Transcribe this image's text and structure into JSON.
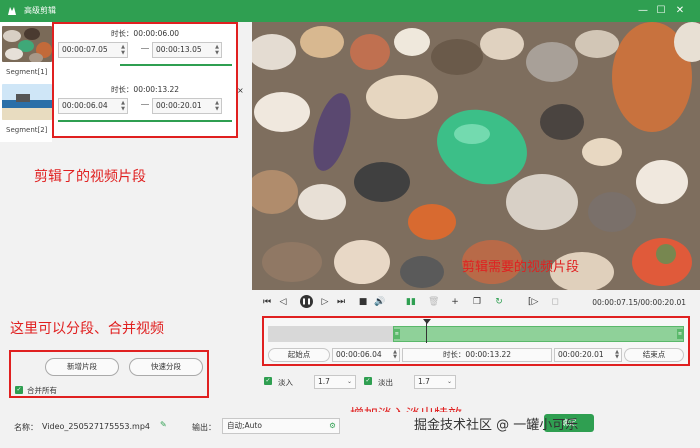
{
  "window": {
    "title": "高级剪辑",
    "minimize": "—",
    "maximize": "☐",
    "close": "✕"
  },
  "segments": {
    "list": [
      {
        "label": "Segment[1]"
      },
      {
        "label": "Segment[2]"
      }
    ],
    "cards": [
      {
        "duration": "时长：00:00:06.00",
        "start": "00:00:07.05",
        "end": "00:00:13.05"
      },
      {
        "duration": "时长：00:00:13.22",
        "start": "00:00:06.04",
        "end": "00:00:20.01"
      }
    ],
    "close": "×"
  },
  "annotations": {
    "segments_note": "剪辑了的视频片段",
    "split_note": "这里可以分段、合并视频",
    "fade_note": "增加淡入淡出特效",
    "video_note": "剪辑需要的视频片段"
  },
  "actions": {
    "add_segment": "新增片段",
    "quick_split": "快速分段",
    "merge_all": "合并所有"
  },
  "player": {
    "time_readout": "00:00:07.15/00:00:20.01"
  },
  "timeline": {
    "start_btn": "起始点",
    "start_time": "00:00:06.04",
    "duration": "时长：00:00:13.22",
    "end_time": "00:00:20.01",
    "end_btn": "结束点",
    "selection_start_fraction": 0.3,
    "playhead_fraction": 0.38
  },
  "fade": {
    "fade_in_label": "淡入",
    "fade_in_value": "1.7",
    "fade_out_label": "淡出",
    "fade_out_value": "1.7"
  },
  "bottom": {
    "name_label": "名称：",
    "file_name": "Video_250527175553.mp4",
    "output_label": "输出：",
    "output_value": "自动;Auto",
    "ok": "确定"
  },
  "watermark": {
    "text": "掘金技术社区 @ 一罐小可乐"
  },
  "colors": {
    "accent": "#2f9f51",
    "annotation": "#e02020"
  }
}
